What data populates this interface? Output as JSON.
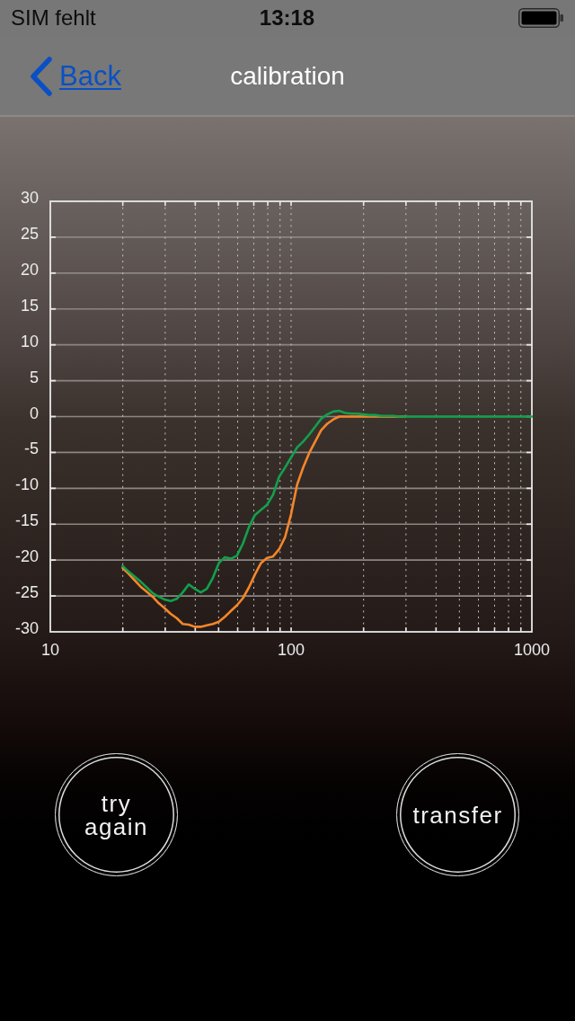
{
  "status_bar": {
    "carrier": "SIM fehlt",
    "time": "13:18"
  },
  "nav_bar": {
    "back": "Back",
    "title": "calibration"
  },
  "chart": {
    "chart_data": {
      "type": "line",
      "grid": true,
      "ylim": [
        -30,
        30
      ],
      "yticks": [
        30,
        25,
        20,
        15,
        10,
        5,
        0,
        -5,
        -10,
        -15,
        -20,
        -25,
        -30
      ],
      "categories": [
        "10",
        null,
        null,
        null,
        null,
        null,
        null,
        null,
        null,
        null,
        null,
        null,
        null,
        null,
        null,
        null,
        null,
        null,
        null,
        null,
        null,
        null,
        null,
        null,
        null,
        null,
        null,
        null,
        null,
        null,
        null,
        null,
        null,
        null,
        null,
        null,
        null,
        null,
        null,
        null,
        "100",
        null,
        null,
        null,
        null,
        null,
        null,
        null,
        null,
        null,
        null,
        null,
        null,
        null,
        null,
        null,
        null,
        null,
        null,
        null,
        null,
        null,
        null,
        null,
        null,
        null,
        null,
        null,
        null,
        null,
        null,
        null,
        null,
        null,
        null,
        null,
        null,
        null,
        null,
        null,
        "1000"
      ],
      "series": [
        {
          "color": "#f5862a",
          "values": [
            null,
            null,
            null,
            null,
            null,
            null,
            null,
            null,
            null,
            null,
            null,
            null,
            -21.1,
            -21.9,
            -22.8,
            -23.7,
            -24.4,
            -25.1,
            -26.0,
            -26.7,
            -27.5,
            -28.1,
            -28.9,
            -29.0,
            -29.3,
            -29.3,
            -29.1,
            -28.9,
            -28.6,
            -27.9,
            -27.1,
            -26.3,
            -25.3,
            -23.8,
            -22.0,
            -20.4,
            -19.7,
            -19.5,
            -18.5,
            -16.8,
            -13.6,
            -9.5,
            -7.1,
            -5.1,
            -3.5,
            -1.9,
            -1.0,
            -0.4,
            0,
            0,
            0,
            0,
            0,
            0,
            0,
            0,
            0,
            0,
            0,
            0,
            null,
            null,
            null,
            null,
            null,
            null,
            null,
            null,
            null,
            null,
            null,
            null,
            null,
            null,
            null,
            null,
            null,
            null,
            null,
            null,
            null
          ]
        },
        {
          "color": "#12a04c",
          "values": [
            null,
            null,
            null,
            null,
            null,
            null,
            null,
            null,
            null,
            null,
            null,
            null,
            -20.8,
            -21.6,
            -22.3,
            -23.0,
            -23.8,
            -24.6,
            -25.1,
            -25.5,
            -25.7,
            -25.4,
            -24.5,
            -23.4,
            -24.0,
            -24.5,
            -24.0,
            -22.5,
            -20.4,
            -19.6,
            -19.8,
            -19.4,
            -17.7,
            -15.4,
            -13.7,
            -13.0,
            -12.3,
            -10.9,
            -8.4,
            -7.1,
            -5.7,
            -4.3,
            -3.5,
            -2.5,
            -1.4,
            -0.3,
            0.3,
            0.7,
            0.8,
            0.5,
            0.4,
            0.4,
            0.3,
            0.2,
            0.2,
            0.1,
            0.1,
            0.1,
            0,
            0,
            0,
            0,
            0,
            0,
            0,
            0,
            0,
            0,
            0,
            0,
            0,
            0,
            0,
            0,
            0,
            0,
            0,
            0,
            0,
            0,
            0
          ]
        }
      ]
    }
  },
  "buttons": [
    "try again",
    "transfer"
  ]
}
